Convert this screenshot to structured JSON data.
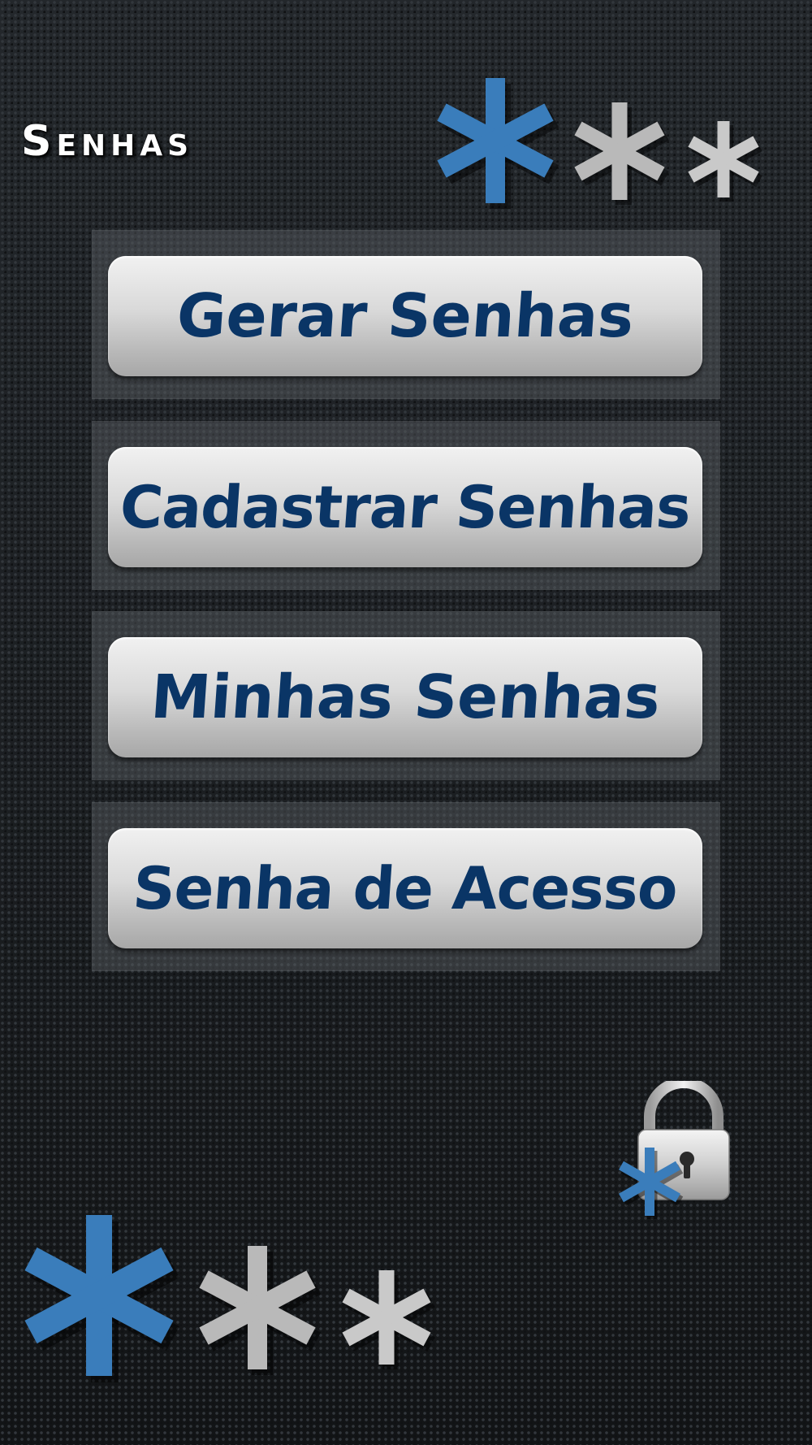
{
  "header": {
    "title": "Senhas",
    "decor_icon": "asterisk-icon",
    "decor_colors": [
      "#3a7dbb",
      "#b9b9b9",
      "#c9c9c9"
    ]
  },
  "menu": {
    "items": [
      {
        "label": "Gerar Senhas"
      },
      {
        "label": "Cadastrar Senhas"
      },
      {
        "label": "Minhas Senhas"
      },
      {
        "label": "Senha de Acesso"
      }
    ],
    "label_color": "#0a3566"
  },
  "decorations": {
    "lock_icon": "padlock-icon",
    "bottom_icon": "asterisk-icon"
  }
}
